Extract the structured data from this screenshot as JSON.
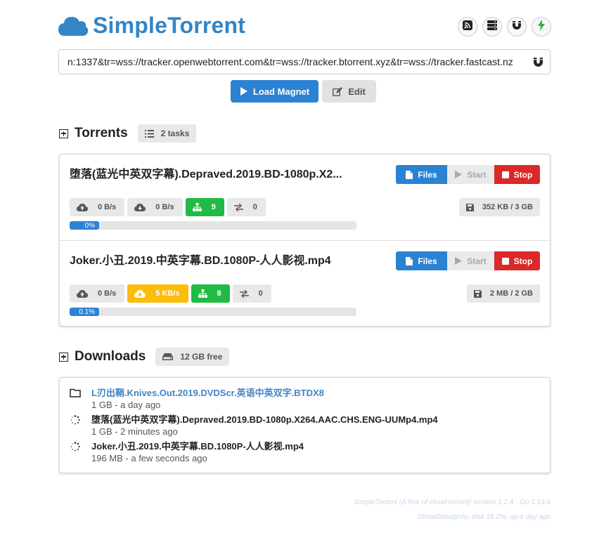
{
  "header": {
    "title": "SimpleTorrent",
    "logo_icon": "cloud-icon",
    "buttons": [
      {
        "icon": "rss-icon"
      },
      {
        "icon": "server-icon"
      },
      {
        "icon": "magnet-icon"
      },
      {
        "icon": "bolt-icon"
      }
    ]
  },
  "magnet": {
    "value": "n:1337&tr=wss://tracker.openwebtorrent.com&tr=wss://tracker.btorrent.xyz&tr=wss://tracker.fastcast.nz",
    "load_label": "Load Magnet",
    "edit_label": "Edit"
  },
  "torrents": {
    "title": "Torrents",
    "count_label": "2 tasks",
    "items": [
      {
        "name": "堕落(蓝光中英双字幕).Depraved.2019.BD-1080p.X2...",
        "files_label": "Files",
        "start_label": "Start",
        "stop_label": "Stop",
        "upload": "0 B/s",
        "download": "0 B/s",
        "peers": "9",
        "connections": "0",
        "size": "352 KB / 3 GB",
        "progress_label": "0%",
        "progress_value": 0.0,
        "download_active": false
      },
      {
        "name": "Joker.小丑.2019.中英字幕.BD.1080P-人人影视.mp4",
        "files_label": "Files",
        "start_label": "Start",
        "stop_label": "Stop",
        "upload": "0 B/s",
        "download": "5 KB/s",
        "peers": "8",
        "connections": "0",
        "size": "2 MB / 2 GB",
        "progress_label": "0.1%",
        "progress_value": 0.001,
        "download_active": true
      }
    ]
  },
  "downloads": {
    "title": "Downloads",
    "free_label": "12 GB free",
    "items": [
      {
        "icon": "folder-icon",
        "name": "L刃出鞘.Knives.Out.2019.DVDScr.英语中英双字.BTDX8",
        "meta": "1 GB - a day ago"
      },
      {
        "icon": "spinner-icon",
        "name": "堕落(蓝光中英双字幕).Depraved.2019.BD-1080p.X264.AAC.CHS.ENG-UUMp4.mp4",
        "meta": "1 GB - 2 minutes ago"
      },
      {
        "icon": "spinner-icon",
        "name": "Joker.小丑.2019.中英字幕.BD.1080P-人人影视.mp4",
        "meta": "196 MB - a few seconds ago"
      }
    ]
  },
  "footer": {
    "line1": "SimpleTorrent (A fork of cloud-torrent) version 1.2.4 - Go 1.13.6",
    "line2": "ShowDebugInfo, disk 18.2%, up a day ago"
  },
  "colors": {
    "brand": "#3385c6",
    "primary": "#2b82d2",
    "stop": "#db2828",
    "peers": "#21ba45",
    "active_download": "#fbbd08"
  }
}
